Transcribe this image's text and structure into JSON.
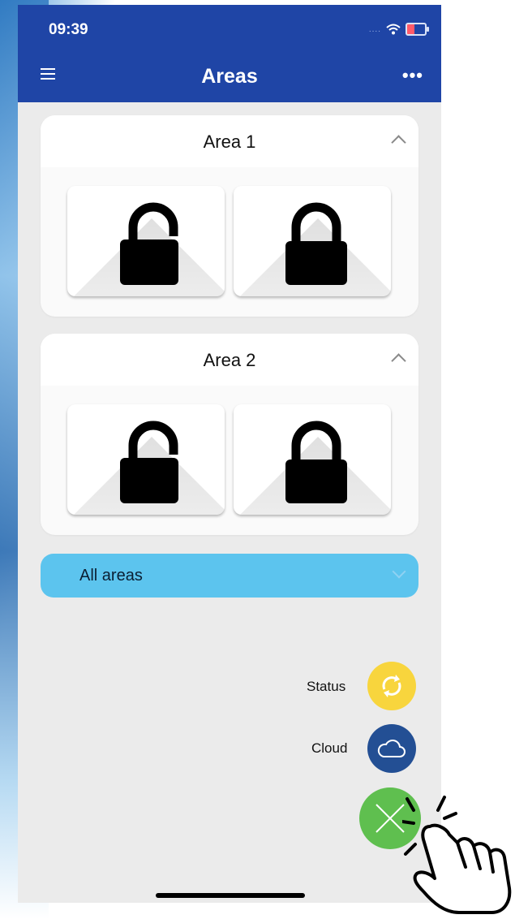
{
  "status_bar": {
    "time": "09:39",
    "signal_text": "....",
    "icons": [
      "wifi-icon",
      "battery-charging-icon"
    ]
  },
  "header": {
    "title": "Areas",
    "menu_icon": "hamburger-menu-icon",
    "more_icon": "more-dots-icon",
    "more_glyph": "•••"
  },
  "colors": {
    "header_bg": "#1f45a6",
    "background": "#ebebeb",
    "all_areas_bg": "#5cc4ee",
    "status_fab": "#f8d53d",
    "cloud_fab": "#234f94",
    "close_fab": "#5fbf4f"
  },
  "areas": [
    {
      "name": "Area 1",
      "locks": [
        "unlocked-padlock-icon",
        "locked-padlock-icon"
      ]
    },
    {
      "name": "Area 2",
      "locks": [
        "unlocked-padlock-icon",
        "locked-padlock-icon"
      ]
    }
  ],
  "all_areas": {
    "label": "All areas"
  },
  "fab_menu": {
    "status_label": "Status",
    "status_icon": "refresh-arrows-icon",
    "cloud_label": "Cloud",
    "cloud_icon": "cloud-icon",
    "close_icon": "close-x-icon"
  }
}
